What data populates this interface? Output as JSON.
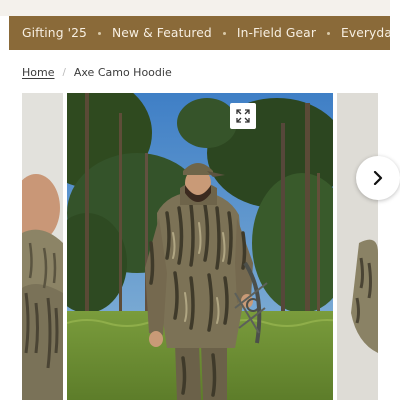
{
  "nav": {
    "items": [
      {
        "label": "Gifting '25"
      },
      {
        "label": "New & Featured"
      },
      {
        "label": "In-Field Gear"
      },
      {
        "label": "Everyday Wear"
      }
    ]
  },
  "breadcrumb": {
    "home": "Home",
    "current": "Axe Camo Hoodie"
  },
  "gallery": {
    "zoom_icon": "expand-icon",
    "next_icon": "chevron-right-icon"
  },
  "colors": {
    "nav_bg": "#8a6a39",
    "nav_text": "#f7efe2",
    "top_strip": "#f4f1ec"
  }
}
